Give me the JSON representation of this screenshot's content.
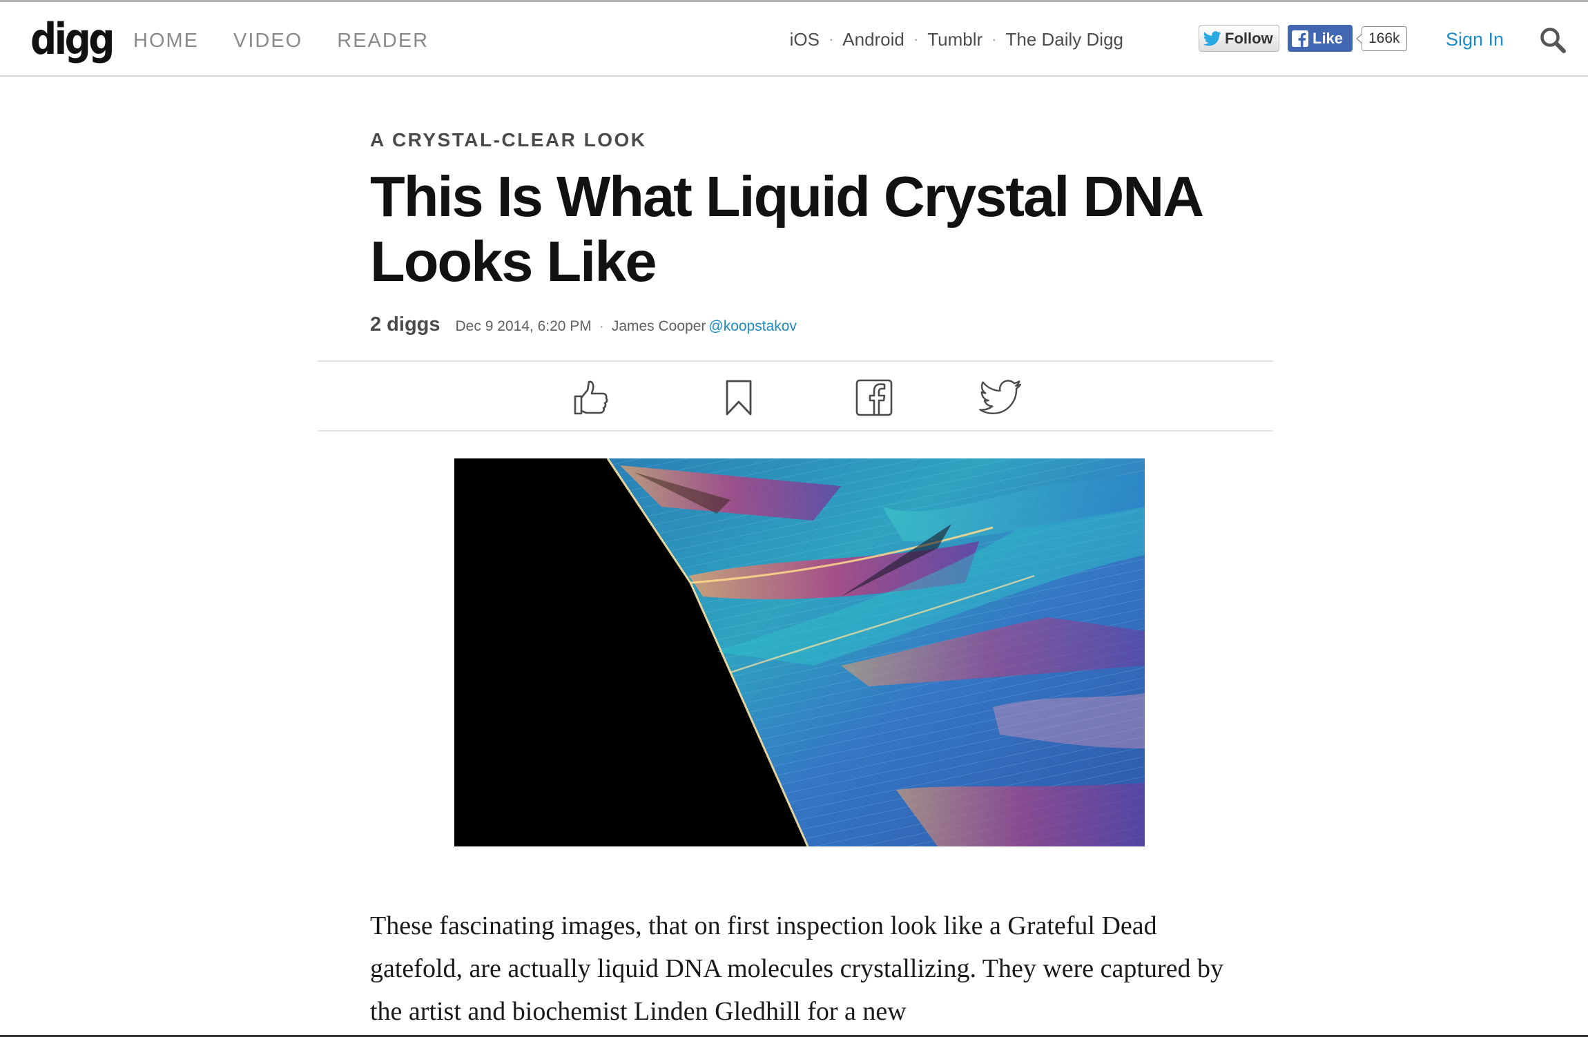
{
  "header": {
    "logo": "digg",
    "nav": [
      "HOME",
      "VIDEO",
      "READER"
    ],
    "app_links": [
      "iOS",
      "Android",
      "Tumblr",
      "The Daily Digg"
    ],
    "twitter_follow_label": "Follow",
    "fb_like_label": "Like",
    "fb_like_count": "166k",
    "sign_in": "Sign In"
  },
  "article": {
    "kicker": "A CRYSTAL-CLEAR LOOK",
    "headline": "This Is What Liquid Crystal DNA Looks Like",
    "diggs": "2 diggs",
    "date": "Dec 9 2014, 6:20 PM",
    "author": "James Cooper",
    "author_handle": "@koopstakov",
    "body": "These fascinating images, that on first inspection look like a Grateful Dead gatefold, are actually liquid DNA molecules crystallizing. They were captured by the artist and biochemist Linden Gledhill for a new"
  },
  "icons": {
    "search": "search-icon",
    "digg_action": "thumbs-up-icon",
    "save_action": "bookmark-icon",
    "facebook_share": "facebook-icon",
    "twitter_share": "twitter-icon"
  },
  "colors": {
    "link_blue": "#1e8bc3",
    "facebook_blue": "#4267b2",
    "twitter_blue": "#1da1f2"
  }
}
